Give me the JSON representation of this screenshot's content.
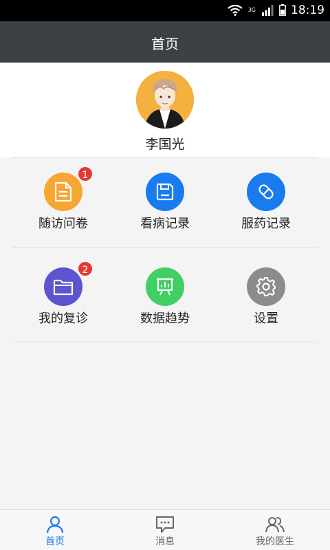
{
  "status_bar": {
    "time": "18:19",
    "network": "3G"
  },
  "header": {
    "title": "首页"
  },
  "profile": {
    "name": "李国光"
  },
  "menu": {
    "items": [
      {
        "label": "随访问卷",
        "badge": "1",
        "color": "#f7a634",
        "icon": "document-icon"
      },
      {
        "label": "看病记录",
        "badge": "",
        "color": "#1a7bf0",
        "icon": "floppy-disk-icon"
      },
      {
        "label": "服药记录",
        "badge": "",
        "color": "#1a7bf0",
        "icon": "pill-icon"
      },
      {
        "label": "我的复诊",
        "badge": "2",
        "color": "#5b55cf",
        "icon": "folder-icon"
      },
      {
        "label": "数据趋势",
        "badge": "",
        "color": "#3fcf64",
        "icon": "chart-board-icon"
      },
      {
        "label": "设置",
        "badge": "",
        "color": "#8c8c8c",
        "icon": "gear-icon"
      }
    ]
  },
  "bottom_nav": {
    "tabs": [
      {
        "label": "首页",
        "active": true,
        "icon": "person-icon"
      },
      {
        "label": "消息",
        "active": false,
        "icon": "message-icon"
      },
      {
        "label": "我的医生",
        "active": false,
        "icon": "people-icon"
      }
    ],
    "active_color": "#1e7bea"
  }
}
